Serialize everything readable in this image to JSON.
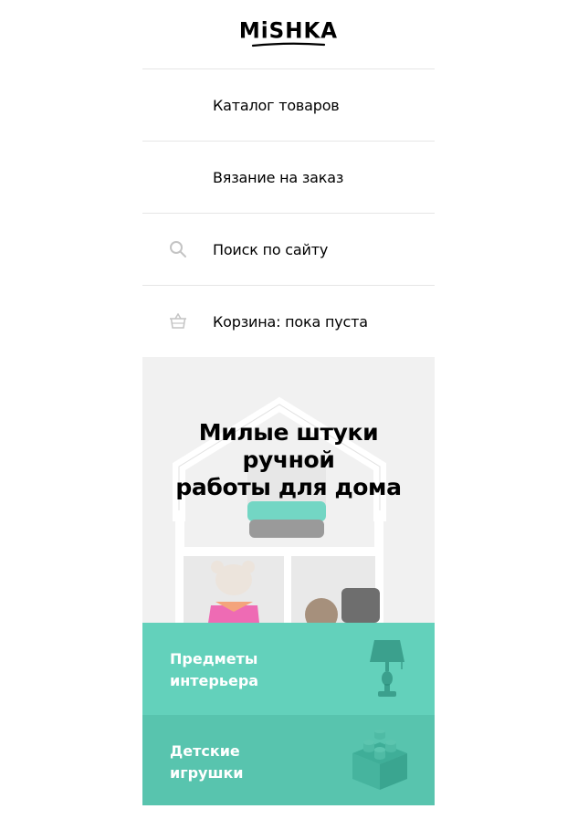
{
  "header": {
    "logo_text": "MiSHKA"
  },
  "nav": {
    "items": [
      {
        "label": "Каталог товаров",
        "icon": ""
      },
      {
        "label": "Вязание на заказ",
        "icon": ""
      },
      {
        "label": "Поиск по сайту",
        "icon": "search-icon"
      },
      {
        "label": "Корзина: пока пуста",
        "icon": "basket-icon"
      }
    ]
  },
  "hero": {
    "title_line1": "Милые штуки",
    "title_line2": "ручной",
    "title_line3": "работы для дома"
  },
  "categories": [
    {
      "label_line1": "Предметы",
      "label_line2": "интерьера",
      "icon": "lamp-icon",
      "color": "#63d1bb"
    },
    {
      "label_line1": "Детские",
      "label_line2": "игрушки",
      "icon": "toy-brick-icon",
      "color": "#58c4ae"
    }
  ],
  "colors": {
    "accent": "#63d1bb",
    "accent_dark": "#58c4ae",
    "divider": "#e6e6e6"
  }
}
